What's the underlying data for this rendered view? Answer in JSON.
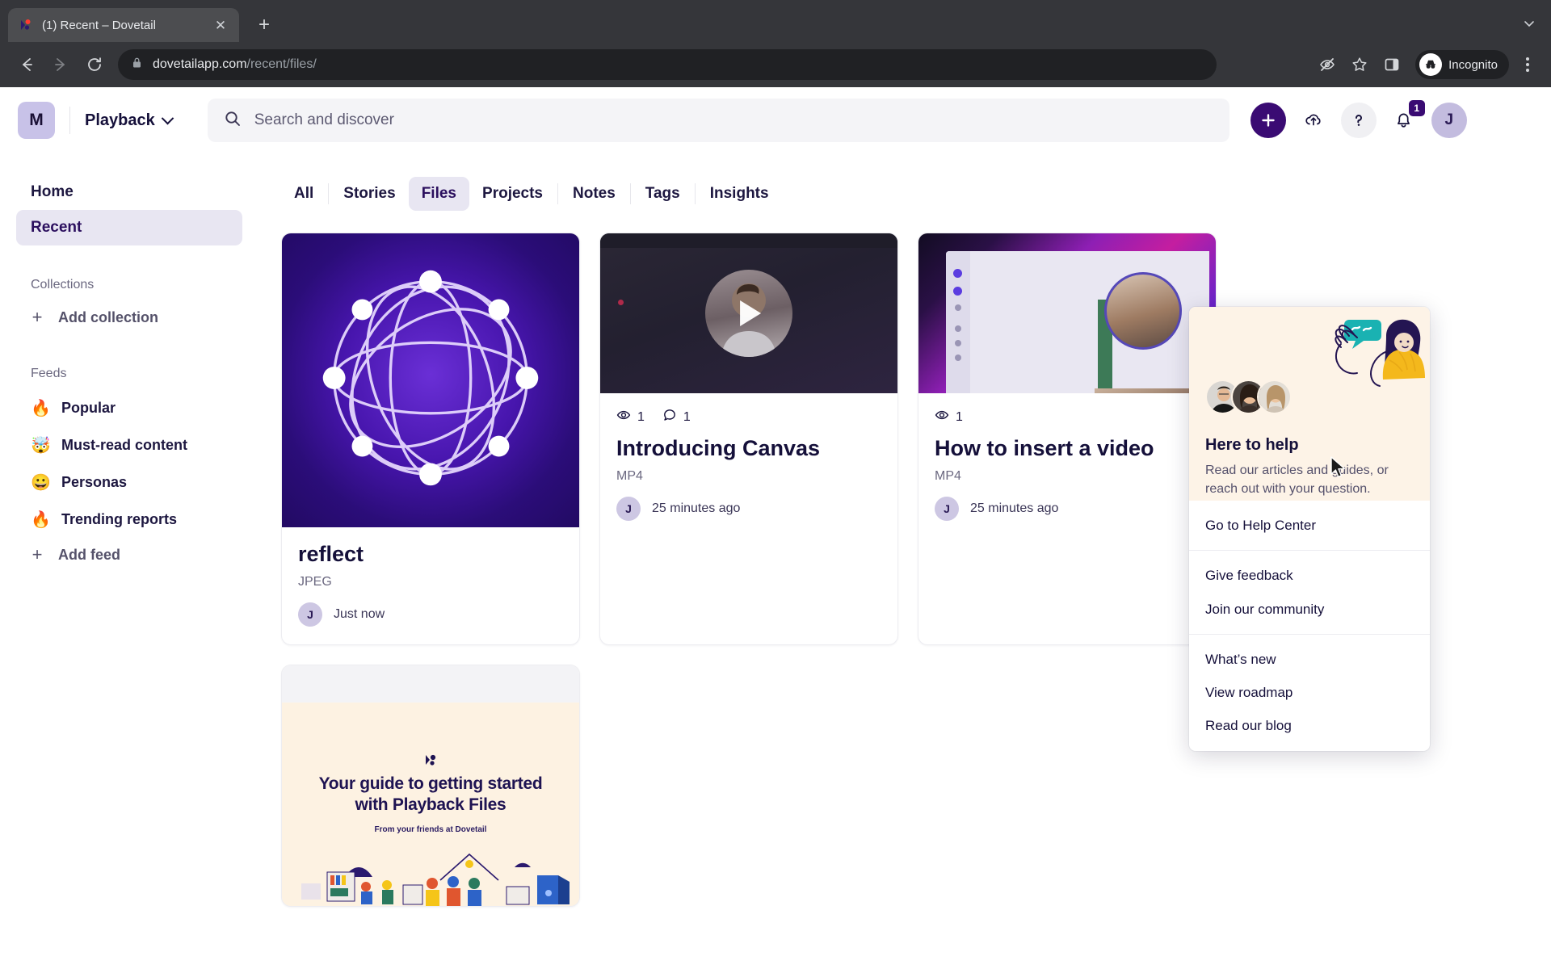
{
  "browser": {
    "tab": {
      "title": "(1) Recent – Dovetail",
      "favicon_icon": "dovetail-favicon",
      "close_icon": "close-icon"
    },
    "new_tab_icon": "plus-icon",
    "tab_list_icon": "chevron-down-icon",
    "nav": {
      "back_icon": "back-arrow-icon",
      "forward_icon": "forward-arrow-icon",
      "reload_icon": "reload-icon"
    },
    "omnibox": {
      "lock_icon": "lock-icon",
      "domain": "dovetailapp.com",
      "path": "/recent/files/"
    },
    "toolbar_right": {
      "tracking_icon": "eye-slash-icon",
      "bookmark_icon": "star-icon",
      "sidepanel_icon": "side-panel-icon",
      "incognito_label": "Incognito",
      "incognito_icon": "incognito-hat-icon",
      "menu_icon": "kebab-menu-icon"
    }
  },
  "header": {
    "workspace_initial": "M",
    "workspace_name": "Playback",
    "workspace_chevron_icon": "chevron-down-icon",
    "search": {
      "placeholder": "Search and discover",
      "icon": "search-icon"
    },
    "actions": {
      "create_icon": "plus-icon",
      "upload_icon": "cloud-upload-icon",
      "help_icon": "question-mark-icon",
      "notifications_icon": "bell-icon",
      "notifications_count": "1",
      "user_initial": "J"
    }
  },
  "sidebar": {
    "nav": [
      {
        "label": "Home",
        "selected": false
      },
      {
        "label": "Recent",
        "selected": true
      }
    ],
    "collections": {
      "heading": "Collections",
      "add_label": "Add collection",
      "add_icon": "plus-icon"
    },
    "feeds": {
      "heading": "Feeds",
      "items": [
        {
          "emoji": "🔥",
          "label": "Popular",
          "icon": "fire-emoji"
        },
        {
          "emoji": "🤯",
          "label": "Must-read content",
          "icon": "exploding-head-emoji"
        },
        {
          "emoji": "😀",
          "label": "Personas",
          "icon": "grinning-face-emoji"
        },
        {
          "emoji": "🔥",
          "label": "Trending reports",
          "icon": "fire-emoji"
        }
      ],
      "add_label": "Add feed",
      "add_icon": "plus-icon"
    }
  },
  "main": {
    "tabs": [
      {
        "label": "All",
        "active": false
      },
      {
        "label": "Stories",
        "active": false
      },
      {
        "label": "Files",
        "active": true
      },
      {
        "label": "Projects",
        "active": false
      },
      {
        "label": "Notes",
        "active": false
      },
      {
        "label": "Tags",
        "active": false
      },
      {
        "label": "Insights",
        "active": false
      }
    ],
    "cards": [
      {
        "thumb": "reflect-network-sphere",
        "title": "reflect",
        "type": "JPEG",
        "author_initial": "J",
        "time": "Just now",
        "views": null,
        "comments": null
      },
      {
        "thumb": "video-dark-webcam",
        "title": "Introducing Canvas",
        "type": "MP4",
        "author_initial": "J",
        "time": "25 minutes ago",
        "views": "1",
        "comments": "1"
      },
      {
        "thumb": "video-screenshare-pink",
        "title": "How to insert a video",
        "type": "MP4",
        "author_initial": "J",
        "time": "25 minutes ago",
        "views": "1",
        "comments": null
      }
    ],
    "guide_card": {
      "logo_icon": "dovetail-logo-icon",
      "heading_line1": "Your guide to getting started",
      "heading_line2": "with Playback Files",
      "subheading": "From your friends at Dovetail"
    }
  },
  "help_popup": {
    "hero": {
      "title": "Here to help",
      "description": "Read our articles and guides, or reach out with your question.",
      "illustration_icon": "waving-person-illustration",
      "avatars_icon": "support-team-avatars"
    },
    "groups": [
      {
        "items": [
          {
            "label": "Go to Help Center"
          }
        ]
      },
      {
        "items": [
          {
            "label": "Give feedback"
          },
          {
            "label": "Join our community"
          }
        ]
      },
      {
        "items": [
          {
            "label": "What’s new"
          },
          {
            "label": "View roadmap"
          },
          {
            "label": "Read our blog"
          }
        ]
      }
    ]
  },
  "colors": {
    "brand_purple": "#3a0b73",
    "selected_lilac": "#e8e6f2",
    "popup_cream": "#fdf3e7",
    "text_dark": "#15103a"
  }
}
